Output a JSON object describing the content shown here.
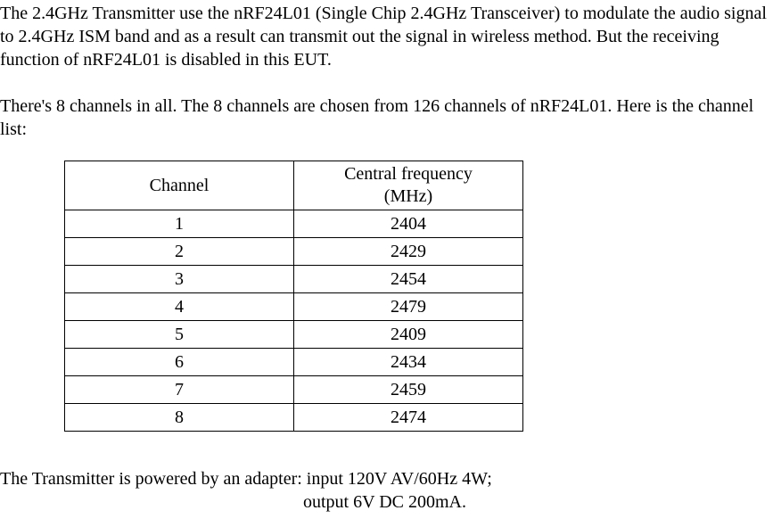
{
  "paragraph1": "The 2.4GHz Transmitter use the nRF24L01 (Single Chip 2.4GHz Transceiver) to modulate the audio signal to 2.4GHz ISM band and as a result can transmit out the signal in wireless method. But the receiving function of nRF24L01 is disabled in this EUT.",
  "paragraph2": "There's 8 channels in all. The 8 channels are chosen from 126 channels of nRF24L01. Here is the channel list:",
  "table": {
    "headers": {
      "channel": "Channel",
      "frequency_l1": "Central frequency",
      "frequency_l2": "(MHz)"
    },
    "rows": [
      {
        "channel": "1",
        "frequency": "2404"
      },
      {
        "channel": "2",
        "frequency": "2429"
      },
      {
        "channel": "3",
        "frequency": "2454"
      },
      {
        "channel": "4",
        "frequency": "2479"
      },
      {
        "channel": "5",
        "frequency": "2409"
      },
      {
        "channel": "6",
        "frequency": "2434"
      },
      {
        "channel": "7",
        "frequency": "2459"
      },
      {
        "channel": "8",
        "frequency": "2474"
      }
    ]
  },
  "power": {
    "line1": "The Transmitter is powered by an adapter: input 120V AV/60Hz 4W;",
    "line2": "output 6V DC 200mA."
  }
}
